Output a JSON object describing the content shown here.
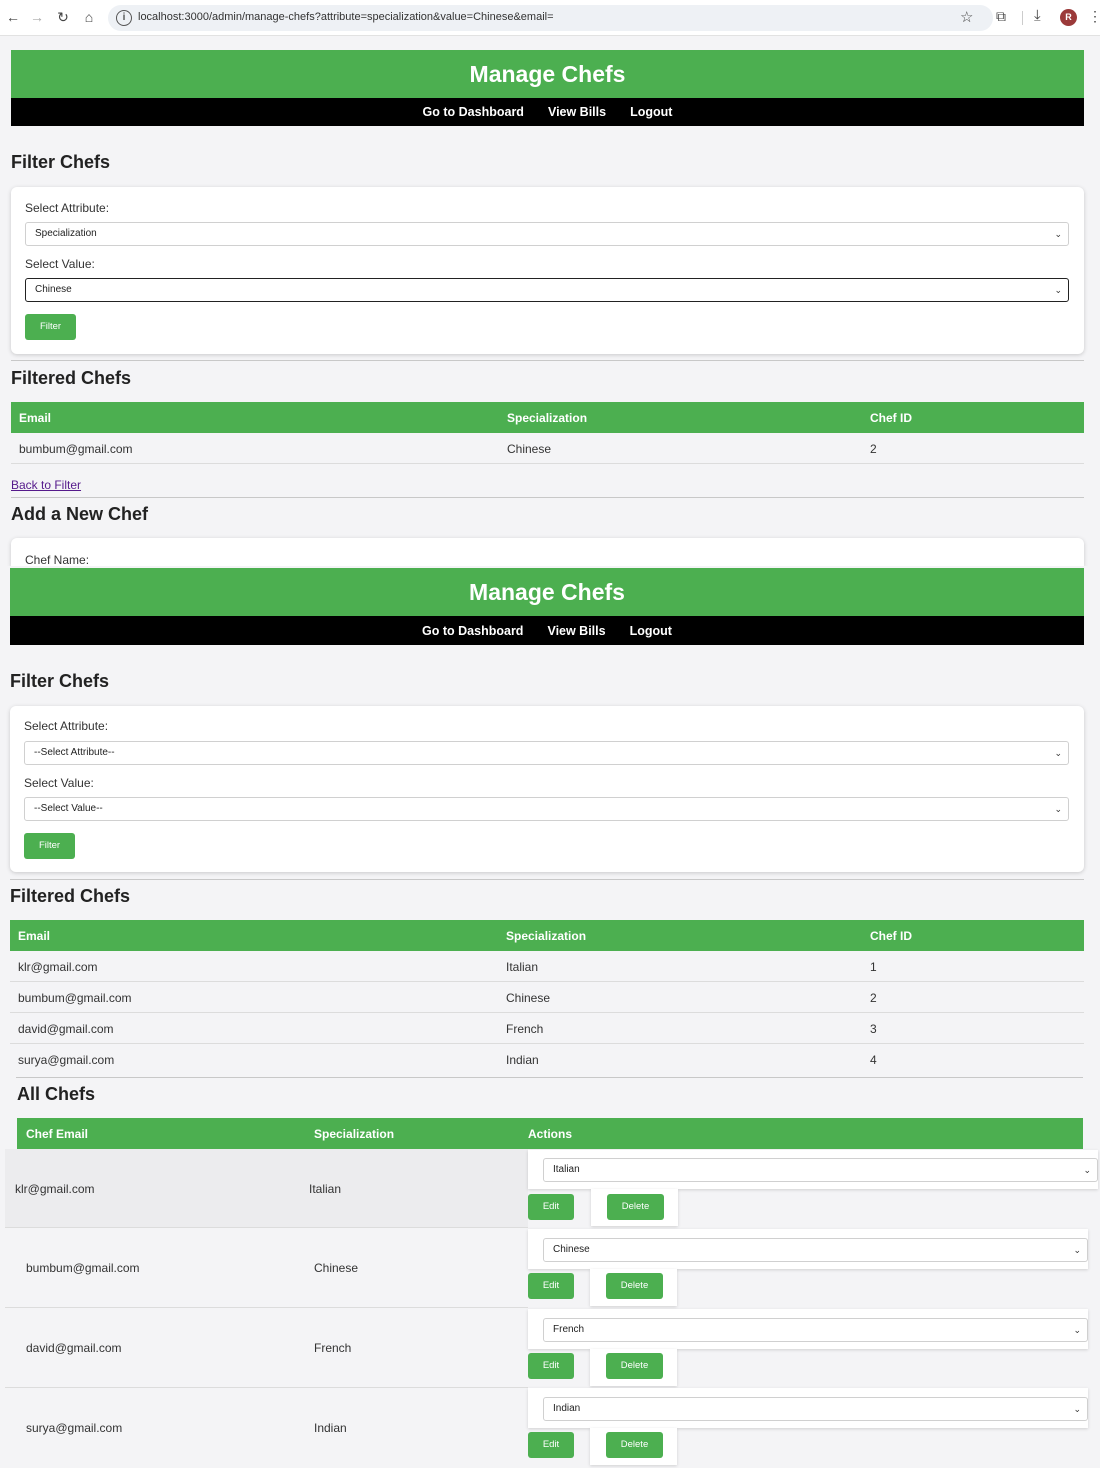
{
  "browser": {
    "url": "localhost:3000/admin/manage-chefs?attribute=specialization&value=Chinese&email=",
    "avatar_letter": "R"
  },
  "shot1": {
    "header_title": "Manage Chefs",
    "nav": [
      "Go to Dashboard",
      "View Bills",
      "Logout"
    ],
    "filter_heading": "Filter Chefs",
    "attr_label": "Select Attribute:",
    "attr_value": "Specialization",
    "value_label": "Select Value:",
    "value_value": "Chinese",
    "filter_btn": "Filter",
    "filtered_heading": "Filtered Chefs",
    "table_headers": [
      "Email",
      "Specialization",
      "Chef ID"
    ],
    "rows": [
      {
        "email": "bumbum@gmail.com",
        "specialization": "Chinese",
        "id": "2"
      }
    ],
    "back_link": "Back to Filter",
    "add_heading": "Add a New Chef",
    "chef_name_label": "Chef Name:"
  },
  "shot2": {
    "header_title": "Manage Chefs",
    "nav": [
      "Go to Dashboard",
      "View Bills",
      "Logout"
    ],
    "filter_heading": "Filter Chefs",
    "attr_label": "Select Attribute:",
    "attr_value": "--Select Attribute--",
    "value_label": "Select Value:",
    "value_value": "--Select Value--",
    "filter_btn": "Filter",
    "filtered_heading": "Filtered Chefs",
    "table_headers": [
      "Email",
      "Specialization",
      "Chef ID"
    ],
    "rows": [
      {
        "email": "klr@gmail.com",
        "specialization": "Italian",
        "id": "1"
      },
      {
        "email": "bumbum@gmail.com",
        "specialization": "Chinese",
        "id": "2"
      },
      {
        "email": "david@gmail.com",
        "specialization": "French",
        "id": "3"
      },
      {
        "email": "surya@gmail.com",
        "specialization": "Indian",
        "id": "4"
      }
    ]
  },
  "shot3": {
    "heading": "All Chefs",
    "table_headers": [
      "Chef Email",
      "Specialization",
      "Actions"
    ],
    "rows": [
      {
        "email": "klr@gmail.com",
        "specialization": "Italian",
        "select": "Italian",
        "edit": "Edit",
        "delete": "Delete"
      },
      {
        "email": "bumbum@gmail.com",
        "specialization": "Chinese",
        "select": "Chinese",
        "edit": "Edit",
        "delete": "Delete"
      },
      {
        "email": "david@gmail.com",
        "specialization": "French",
        "select": "French",
        "edit": "Edit",
        "delete": "Delete"
      },
      {
        "email": "surya@gmail.com",
        "specialization": "Indian",
        "select": "Indian",
        "edit": "Edit",
        "delete": "Delete"
      }
    ]
  },
  "colors": {
    "accent_green": "#4caf50",
    "nav_black": "#000000",
    "page_bg": "#f4f4f6"
  }
}
